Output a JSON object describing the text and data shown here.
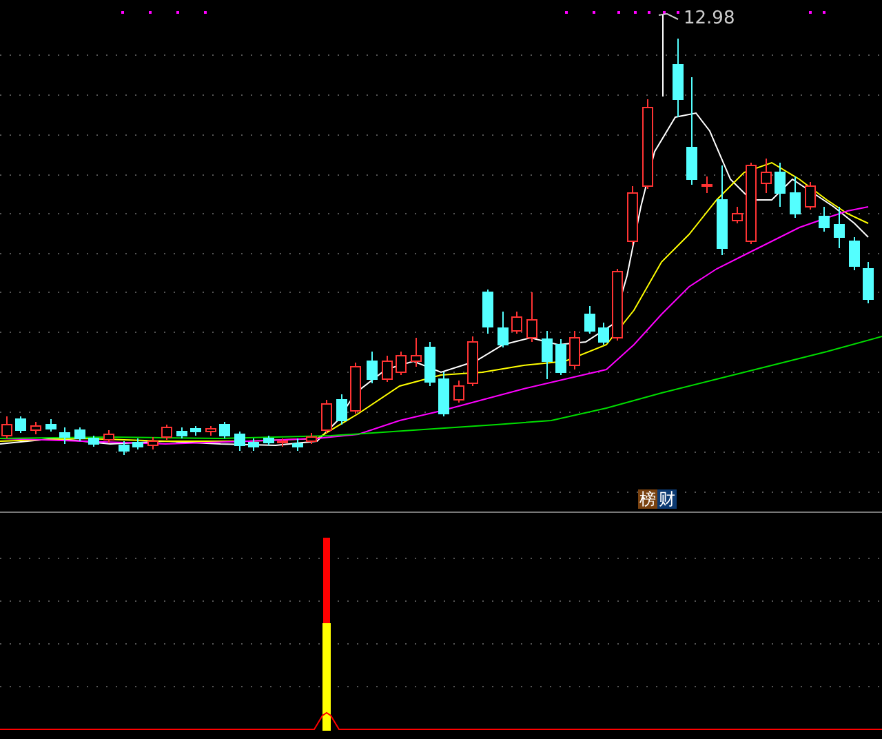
{
  "price_chart": {
    "high_label": "12.98",
    "badges": [
      {
        "text": "榜",
        "color": "#7a4210"
      },
      {
        "text": "财",
        "color": "#0c3a72"
      }
    ]
  }
}
